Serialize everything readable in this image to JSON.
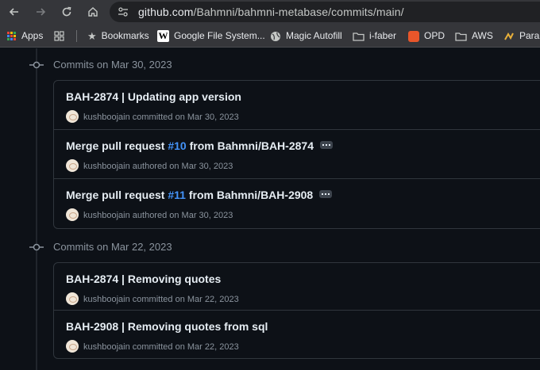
{
  "browser": {
    "url_host": "github.com",
    "url_path": "/Bahmni/bahmni-metabase/commits/main/",
    "bookmarks": [
      {
        "label": "Apps",
        "icon": "apps-grid-icon"
      },
      {
        "label": "",
        "icon": "tab-groups-icon"
      },
      {
        "label": "Bookmarks",
        "icon": "star-icon"
      },
      {
        "label": "Google File System...",
        "icon": "wikipedia-icon"
      },
      {
        "label": "Magic Autofill",
        "icon": "globe-icon"
      },
      {
        "label": "i-faber",
        "icon": "folder-icon"
      },
      {
        "label": "OPD",
        "icon": "opd-favicon"
      },
      {
        "label": "AWS",
        "icon": "folder-icon"
      },
      {
        "label": "Parall",
        "icon": "parall-favicon"
      }
    ]
  },
  "groups": [
    {
      "title": "Commits on Mar 30, 2023",
      "commits": [
        {
          "title_pre": "BAH-2874 | Updating app version",
          "pr": "",
          "title_post": "",
          "has_ellipsis": false,
          "author": "kushboojain",
          "action": "committed on Mar 30, 2023"
        },
        {
          "title_pre": "Merge pull request ",
          "pr": "#10",
          "title_post": " from Bahmni/BAH-2874",
          "has_ellipsis": true,
          "author": "kushboojain",
          "action": "authored on Mar 30, 2023"
        },
        {
          "title_pre": "Merge pull request ",
          "pr": "#11",
          "title_post": " from Bahmni/BAH-2908",
          "has_ellipsis": true,
          "author": "kushboojain",
          "action": "authored on Mar 30, 2023"
        }
      ]
    },
    {
      "title": "Commits on Mar 22, 2023",
      "commits": [
        {
          "title_pre": "BAH-2874 | Removing quotes",
          "pr": "",
          "title_post": "",
          "has_ellipsis": false,
          "author": "kushboojain",
          "action": "committed on Mar 22, 2023"
        },
        {
          "title_pre": "BAH-2908 | Removing quotes from sql",
          "pr": "",
          "title_post": "",
          "has_ellipsis": false,
          "author": "kushboojain",
          "action": "committed on Mar 22, 2023"
        }
      ]
    }
  ]
}
